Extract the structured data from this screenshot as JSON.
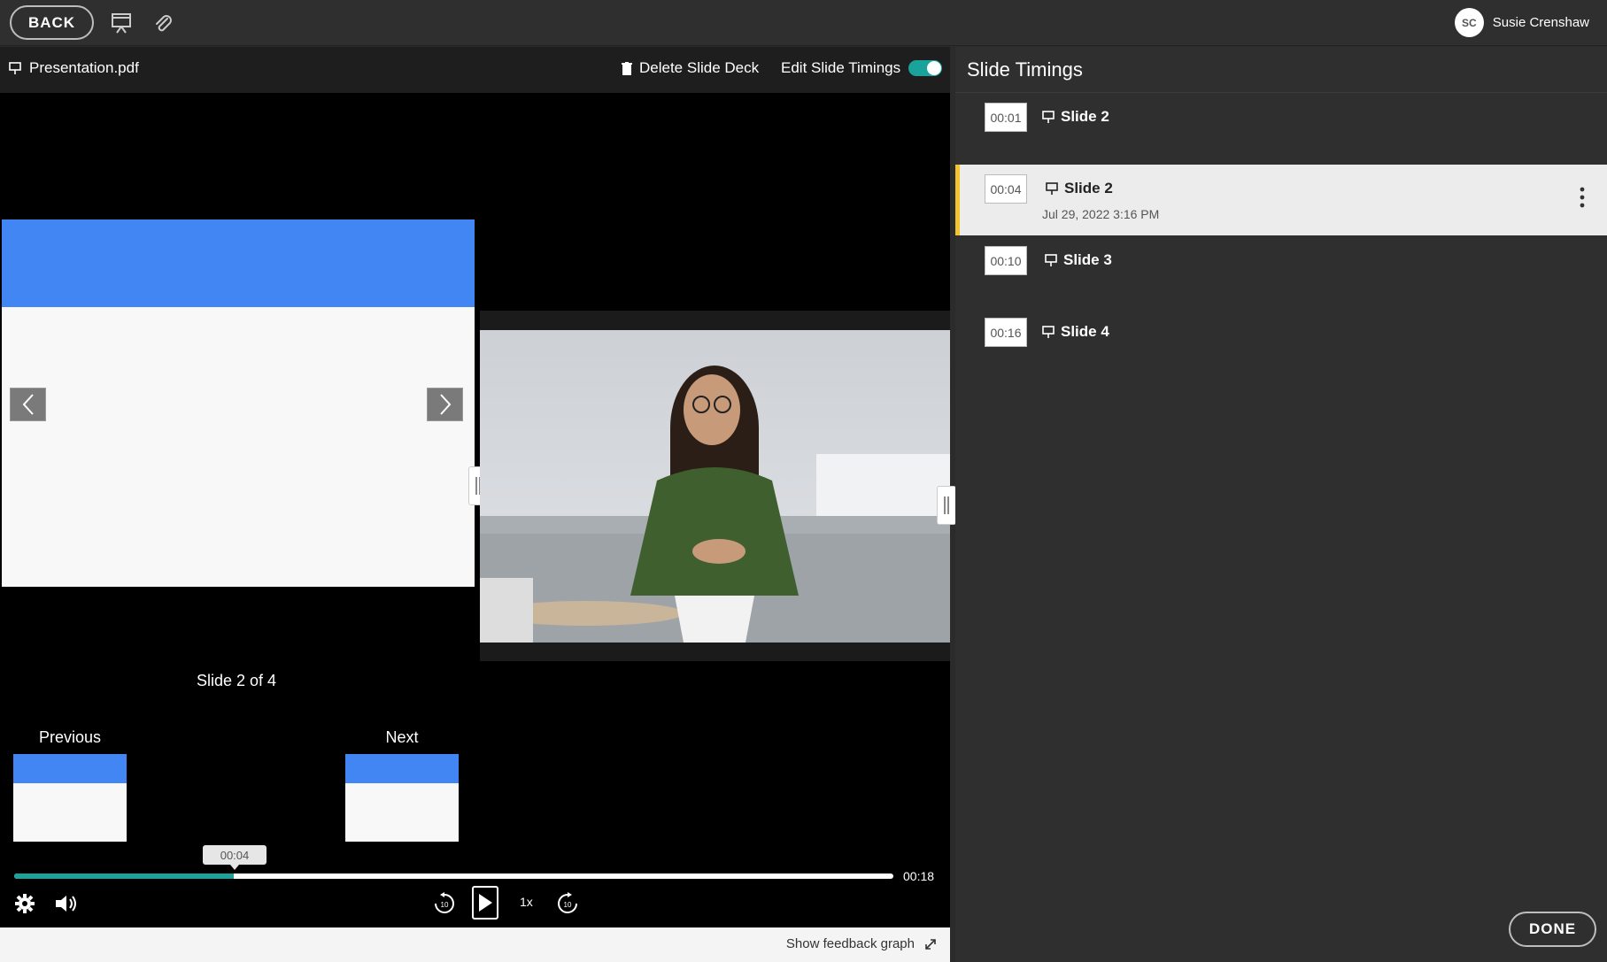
{
  "topbar": {
    "back_label": "BACK",
    "icons": [
      "presentation-icon",
      "paperclip-icon"
    ],
    "user": {
      "initials": "SC",
      "name": "Susie Crenshaw"
    }
  },
  "viewer": {
    "file_name": "Presentation.pdf",
    "delete_label": "Delete Slide Deck",
    "edit_timings_label": "Edit Slide Timings",
    "edit_timings_on": true,
    "slide_counter": "Slide 2 of 4",
    "previous_label": "Previous",
    "next_label": "Next",
    "slide_colors": {
      "header": "#4286f4",
      "body": "#f8f8f8"
    }
  },
  "player": {
    "current_time": "00:04",
    "duration": "00:18",
    "progress_fraction": 0.25,
    "speed": "1x",
    "accent": "#1aa39a"
  },
  "feedback": {
    "label": "Show feedback graph"
  },
  "timings": {
    "title": "Slide Timings",
    "items": [
      {
        "time": "00:01",
        "slide": "Slide 2",
        "timestamp": "",
        "active": false
      },
      {
        "time": "00:04",
        "slide": "Slide 2",
        "timestamp": "Jul 29, 2022 3:16 PM",
        "active": true
      },
      {
        "time": "00:10",
        "slide": "Slide 3",
        "timestamp": "",
        "active": false
      },
      {
        "time": "00:16",
        "slide": "Slide 4",
        "timestamp": "",
        "active": false
      }
    ],
    "done_label": "DONE",
    "active_marker": "#f2c230"
  }
}
